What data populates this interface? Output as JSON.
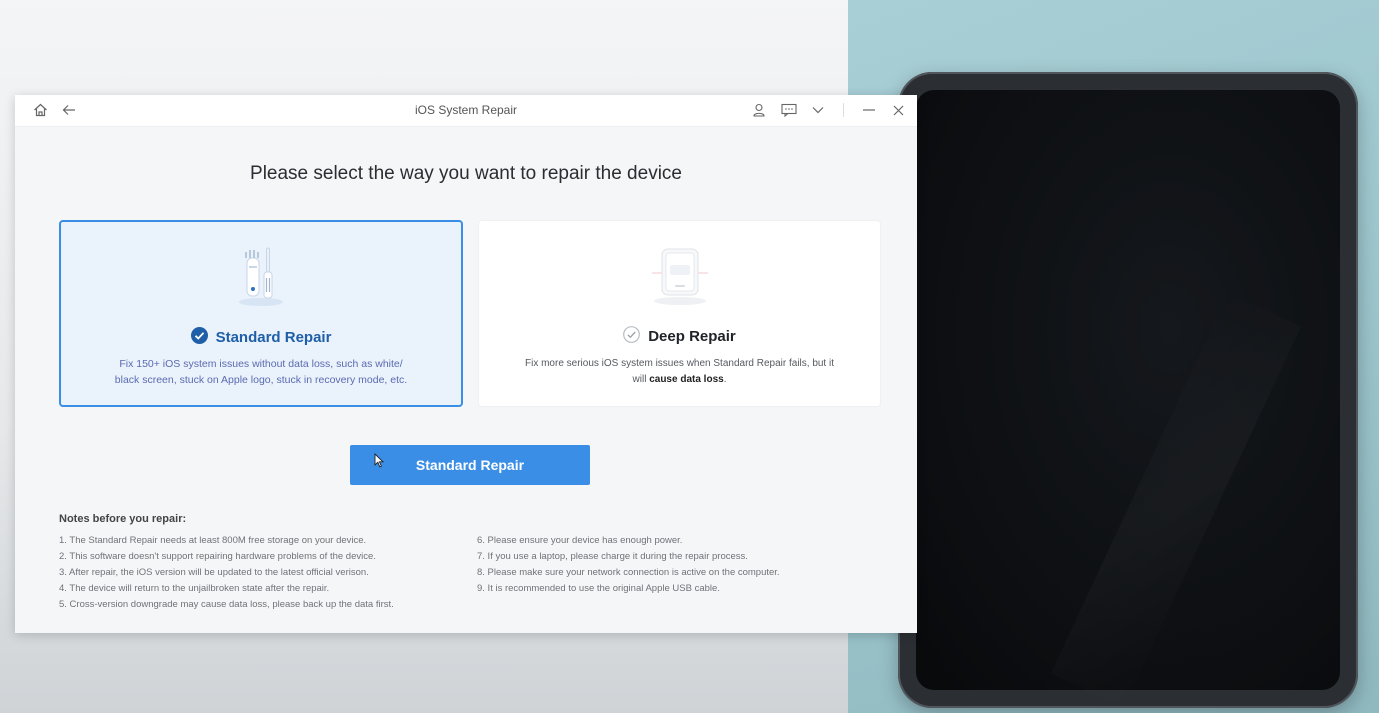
{
  "window": {
    "title": "iOS System Repair"
  },
  "titlebar_icons": [
    "home-icon",
    "back-arrow-icon",
    "user-icon",
    "feedback-icon",
    "chevron-down-icon",
    "minimize-icon",
    "close-icon"
  ],
  "heading": "Please select the way you want to repair the device",
  "options": [
    {
      "title": "Standard Repair",
      "selected": true,
      "description_line1": "Fix 150+ iOS system issues without data loss, such as white/",
      "description_line2": "black screen, stuck on Apple logo, stuck in recovery mode, etc."
    },
    {
      "title": "Deep Repair",
      "selected": false,
      "description_line1": "Fix more serious iOS system issues when Standard Repair fails, but it",
      "description_prefix": "will ",
      "description_bold": "cause data loss",
      "description_suffix": "."
    }
  ],
  "primary_button": "Standard Repair",
  "notes": {
    "title": "Notes before you repair:",
    "left": [
      "1.  The Standard Repair needs at least 800M free storage on your device.",
      "2.  This software doesn't support repairing hardware problems of the device.",
      "3.  After repair, the iOS version will be updated to the latest official verison.",
      "4.  The device will return to the unjailbroken state after the repair.",
      "5.  Cross-version downgrade may cause data loss, please back up the data first."
    ],
    "right": [
      "6.  Please ensure your device has enough power.",
      "7.  If you use a laptop, please charge it during the repair process.",
      "8.  Please make sure your network connection is active on the computer.",
      "9.  It is recommended to use the original Apple USB cable."
    ]
  },
  "colors": {
    "accent": "#3a8ee6",
    "selected_card_bg": "#eaf2fc"
  }
}
